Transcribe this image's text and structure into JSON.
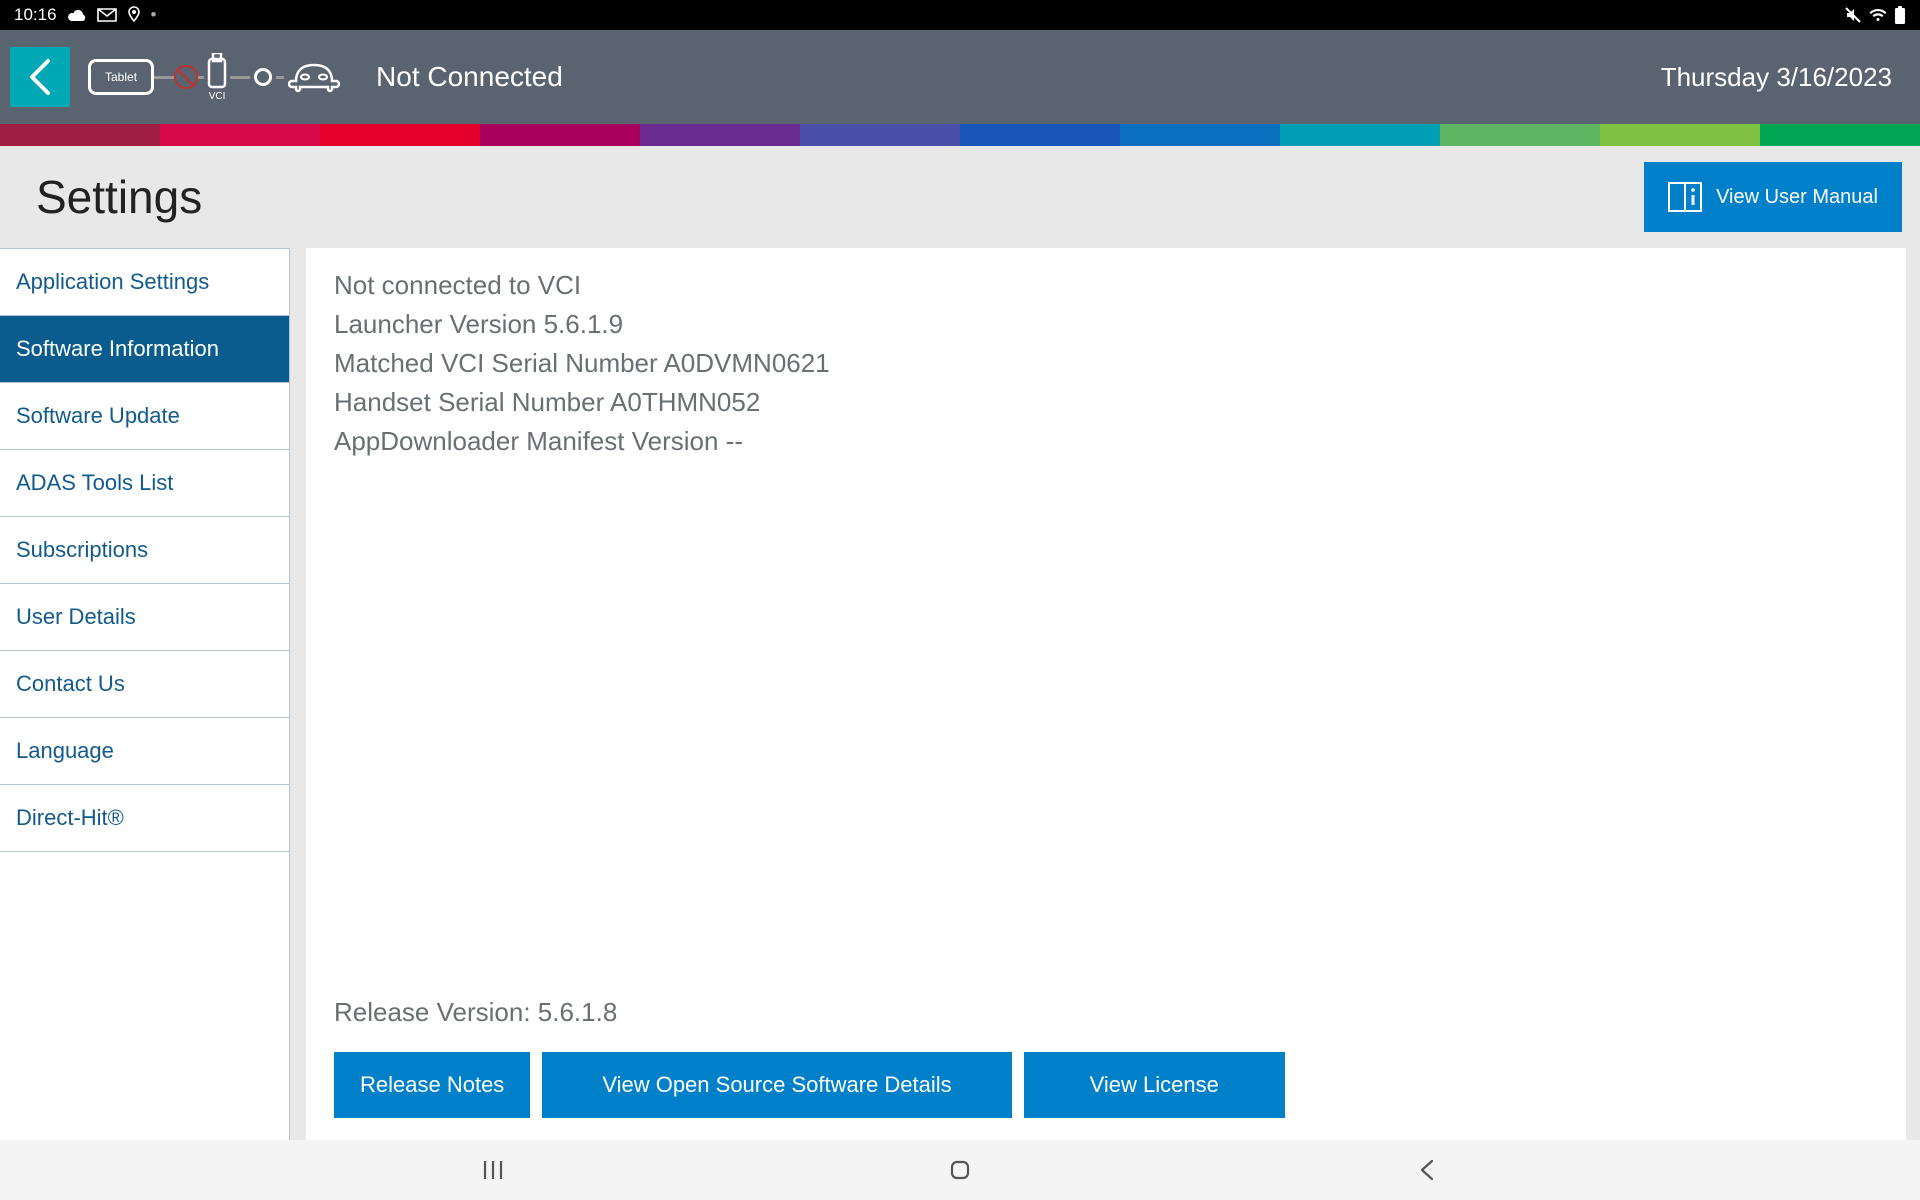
{
  "status_bar": {
    "time": "10:16"
  },
  "header": {
    "tablet_label": "Tablet",
    "vci_label": "VCI",
    "connection_status": "Not Connected",
    "date": "Thursday 3/16/2023"
  },
  "color_strip": [
    "#a01e44",
    "#d8094a",
    "#e4002b",
    "#a8005c",
    "#6b2c91",
    "#4a4fa8",
    "#1857b8",
    "#0a6fbf",
    "#009fb5",
    "#5eb562",
    "#7fc241",
    "#00a651"
  ],
  "page": {
    "title": "Settings",
    "view_manual_label": "View User Manual"
  },
  "sidebar": {
    "items": [
      {
        "label": "Application Settings",
        "active": false
      },
      {
        "label": "Software Information",
        "active": true
      },
      {
        "label": "Software Update",
        "active": false
      },
      {
        "label": "ADAS Tools List",
        "active": false
      },
      {
        "label": "Subscriptions",
        "active": false
      },
      {
        "label": "User Details",
        "active": false
      },
      {
        "label": "Contact Us",
        "active": false
      },
      {
        "label": "Language",
        "active": false
      },
      {
        "label": "Direct-Hit®",
        "active": false
      }
    ]
  },
  "content": {
    "lines": [
      "Not connected to VCI",
      "Launcher Version 5.6.1.9",
      "Matched VCI Serial Number A0DVMN0621",
      "Handset Serial Number A0THMN052",
      "AppDownloader Manifest Version --"
    ],
    "release_version": "Release Version: 5.6.1.8",
    "buttons": {
      "release_notes": "Release Notes",
      "open_source": "View Open Source Software Details",
      "view_license": "View License"
    }
  }
}
